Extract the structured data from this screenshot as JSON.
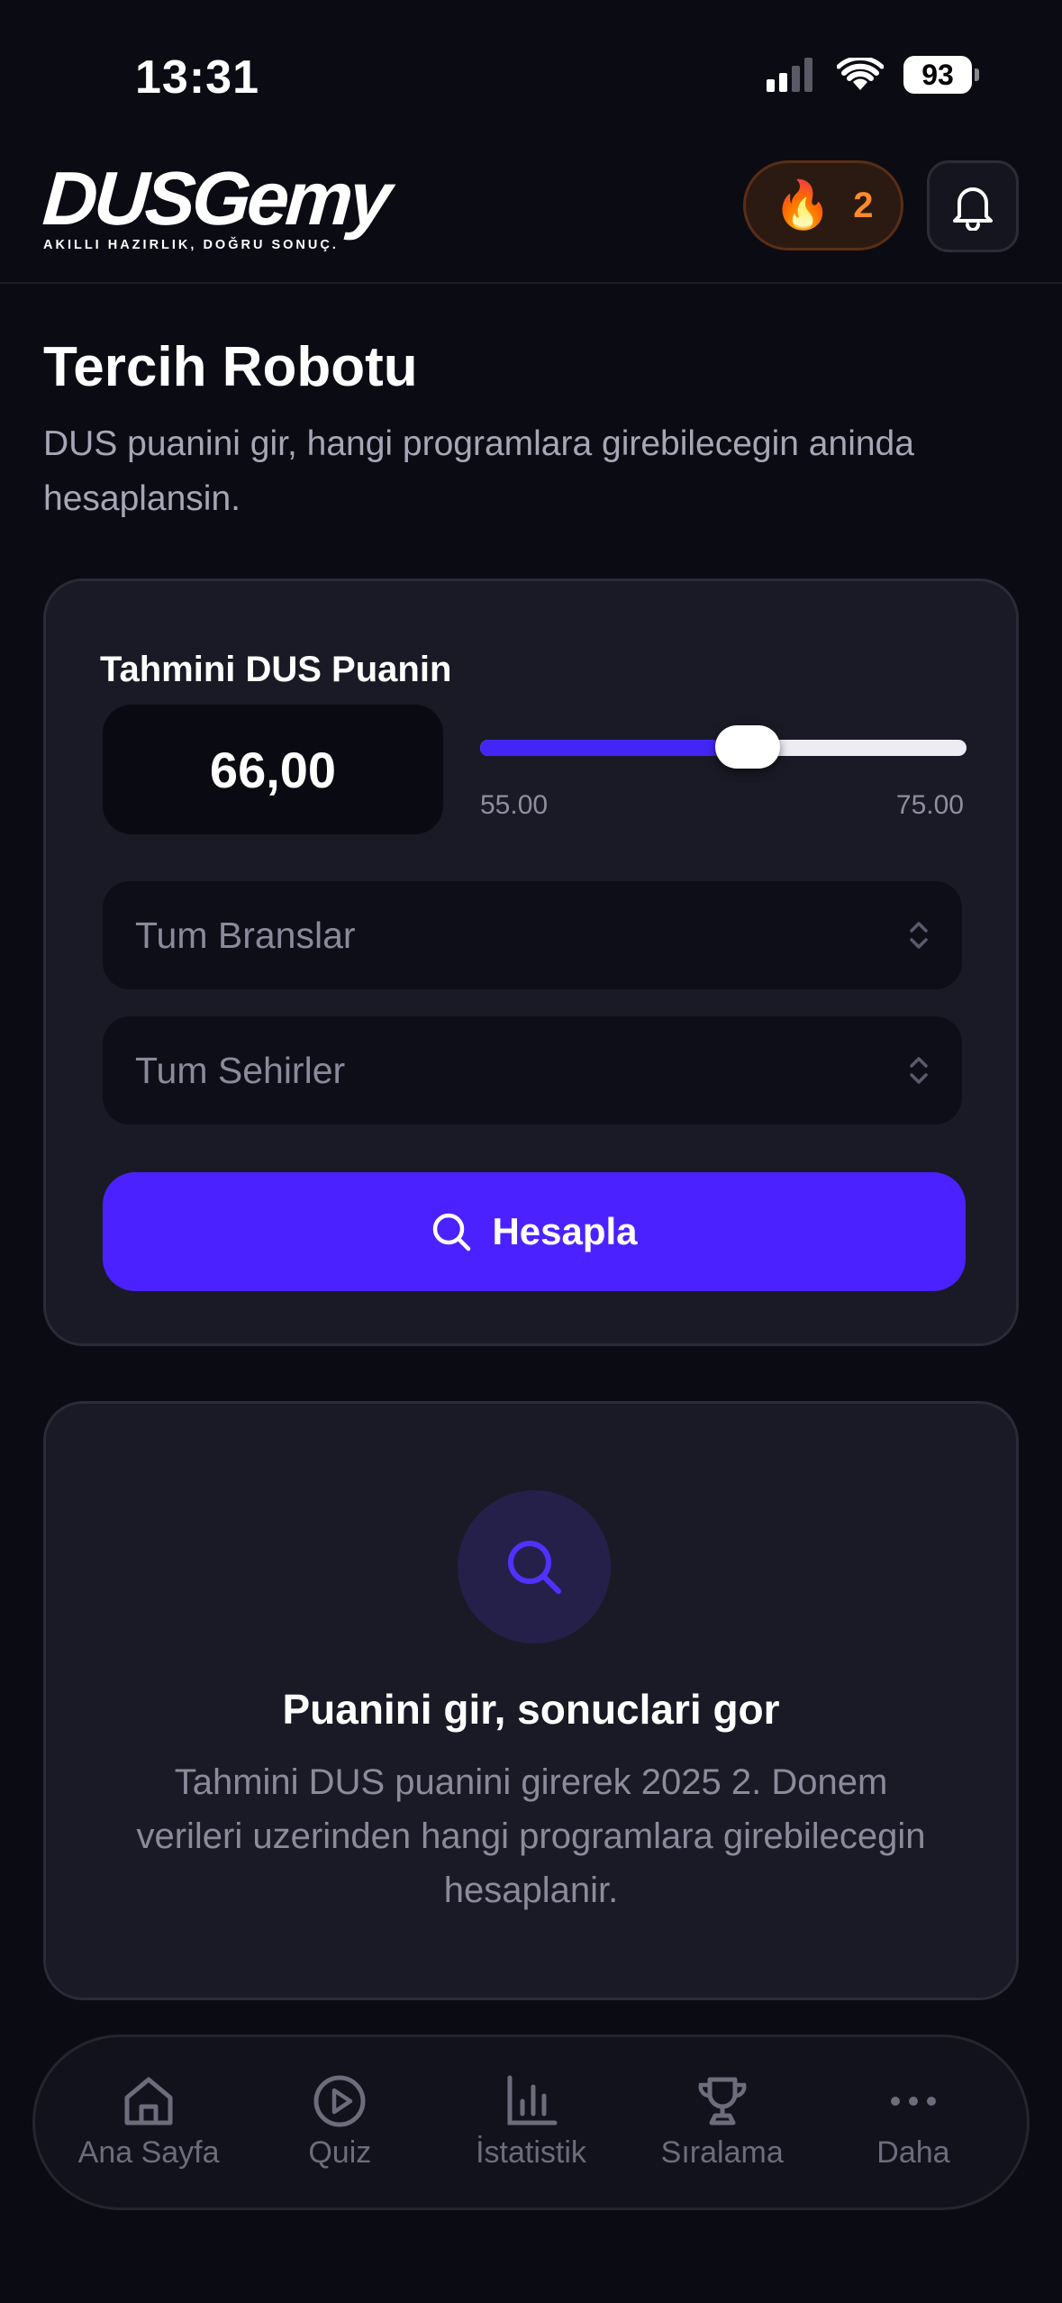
{
  "status_bar": {
    "time": "13:31",
    "battery": "93"
  },
  "header": {
    "logo_text": "DUSGemy",
    "logo_tagline": "AKILLI HAZIRLIK, DOĞRU SONUÇ.",
    "streak_count": "2"
  },
  "page": {
    "title": "Tercih Robotu",
    "subtitle": "DUS puanini gir, hangi programlara girebilecegin aninda hesaplansin."
  },
  "form": {
    "score_label": "Tahmini DUS Puanin",
    "score_value": "66,00",
    "slider": {
      "min_label": "55.00",
      "max_label": "75.00",
      "min": 55,
      "max": 75,
      "value": 66
    },
    "branch_select": "Tum Branslar",
    "city_select": "Tum Sehirler",
    "calculate_label": "Hesapla"
  },
  "empty_state": {
    "title": "Puanini gir, sonuclari gor",
    "description": "Tahmini DUS puanini girerek 2025 2. Donem verileri uzerinden hangi programlara girebilecegin hesaplanir."
  },
  "nav": {
    "items": [
      {
        "label": "Ana Sayfa",
        "icon": "home-icon"
      },
      {
        "label": "Quiz",
        "icon": "play-icon"
      },
      {
        "label": "İstatistik",
        "icon": "chart-icon"
      },
      {
        "label": "Sıralama",
        "icon": "trophy-icon"
      },
      {
        "label": "Daha",
        "icon": "more-icon"
      }
    ]
  },
  "colors": {
    "accent": "#4b22ff",
    "streak": "#ff8a2a",
    "background": "#0b0b14",
    "card": "#1a1a26"
  }
}
